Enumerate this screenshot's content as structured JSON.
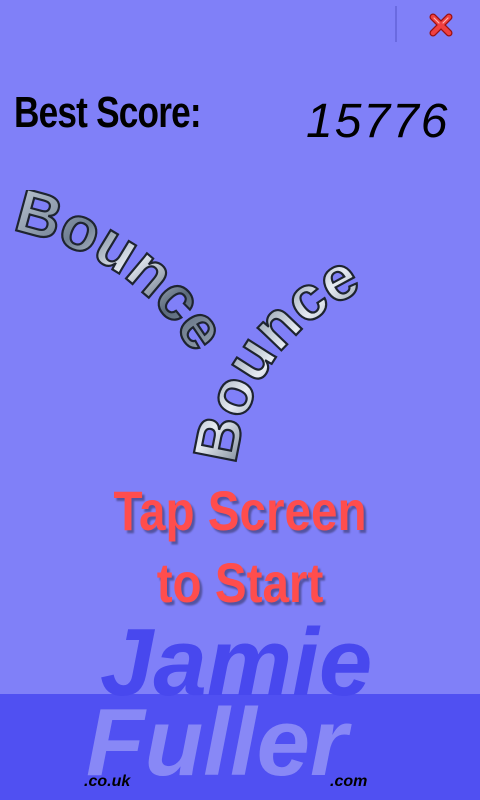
{
  "best_score": {
    "label": "Best Score:",
    "value": "15776"
  },
  "logo": {
    "word_left": "Bounce",
    "word_right": "Bounce"
  },
  "prompt": {
    "line1": "Tap Screen",
    "line2": "to Start"
  },
  "watermark": {
    "first": "Jamie",
    "last": "Fuller",
    "suffix_left": ".co.uk",
    "suffix_right": ".com"
  },
  "icons": {
    "close": "close-icon"
  },
  "colors": {
    "background": "#8080f8",
    "band": "#5050f2",
    "prompt": "#ff4d4d",
    "close": "#e03030"
  }
}
